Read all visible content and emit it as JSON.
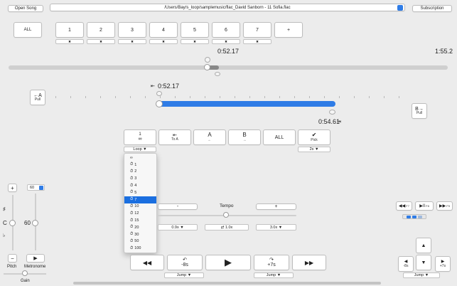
{
  "top": {
    "open_song": "Open Song",
    "file_path": "/Users/Bay/s_loop/samplemusic/flac_David Sanborn - 11 Sofia.flac",
    "subscription": "Subscription"
  },
  "markers": {
    "all": "ALL",
    "items": [
      "1",
      "2",
      "3",
      "4",
      "5",
      "6",
      "7",
      "+"
    ],
    "delete_glyph": "✖"
  },
  "time": {
    "current": "0:52.17",
    "total": "1:55.2"
  },
  "loop": {
    "a_time": "0:52.17",
    "b_time": "0:54.61",
    "pull_a_arrow": "←A",
    "pull_a_label": "Pull",
    "pull_b_arrow": "B→",
    "pull_b_label": "Pull",
    "start_glyph": "⇤",
    "end_glyph": "⇥"
  },
  "loop_controls": {
    "repeat_top": "1",
    "repeat_bottom": "∞",
    "to_a_glyph": "⇤",
    "to_a_label": "To A",
    "a_label": "A",
    "a_arrow": "←",
    "b_label": "B",
    "b_arrow": "→",
    "all": "ALL",
    "pick_glyph": "✔",
    "pick_label": "Pick",
    "loop_select": "Loop ▼",
    "pick_select": "2s ▼"
  },
  "loop_dropdown": {
    "options": [
      "∞",
      "1",
      "2",
      "3",
      "4",
      "5",
      "7",
      "10",
      "12",
      "15",
      "20",
      "30",
      "50",
      "100"
    ],
    "selected": "7",
    "timer_glyph": "⏱"
  },
  "pitch": {
    "plus": "+",
    "minus": "−",
    "sharp": "♯",
    "note": "C",
    "flat": "♭",
    "label": "Pitch"
  },
  "metronome": {
    "value_select": "60",
    "value": "60",
    "play_glyph": "▶",
    "label": "Metronome"
  },
  "gain": {
    "label": "Gain"
  },
  "tempo": {
    "label": "Tempo",
    "minus": "-",
    "plus": "+",
    "slow": "0.9x ▼",
    "normal": "⇄ 1.0x",
    "fast": "3.0x ▼"
  },
  "transport": {
    "rewind": "◀◀",
    "back_glyph": "↶",
    "back_label": "-8s",
    "play": "▶",
    "fwd_glyph": "↷",
    "fwd_label": "+7s",
    "ffwd": "▶▶",
    "jump_back": "Jump ▼",
    "jump_fwd": "Jump ▼"
  },
  "right_panel": {
    "rew": "◀◀",
    "rew_key": "F7",
    "play_pause": "▶II",
    "play_key": "F8",
    "ffw": "▶▶",
    "ffw_key": "F9",
    "up": "▲",
    "down": "▼",
    "left_label": "-8s",
    "right_label": "+7s",
    "jump": "Jump ▼"
  },
  "colors": {
    "accent": "#2f7ce6",
    "selected": "#1b6fe0",
    "background": "#ececec"
  }
}
